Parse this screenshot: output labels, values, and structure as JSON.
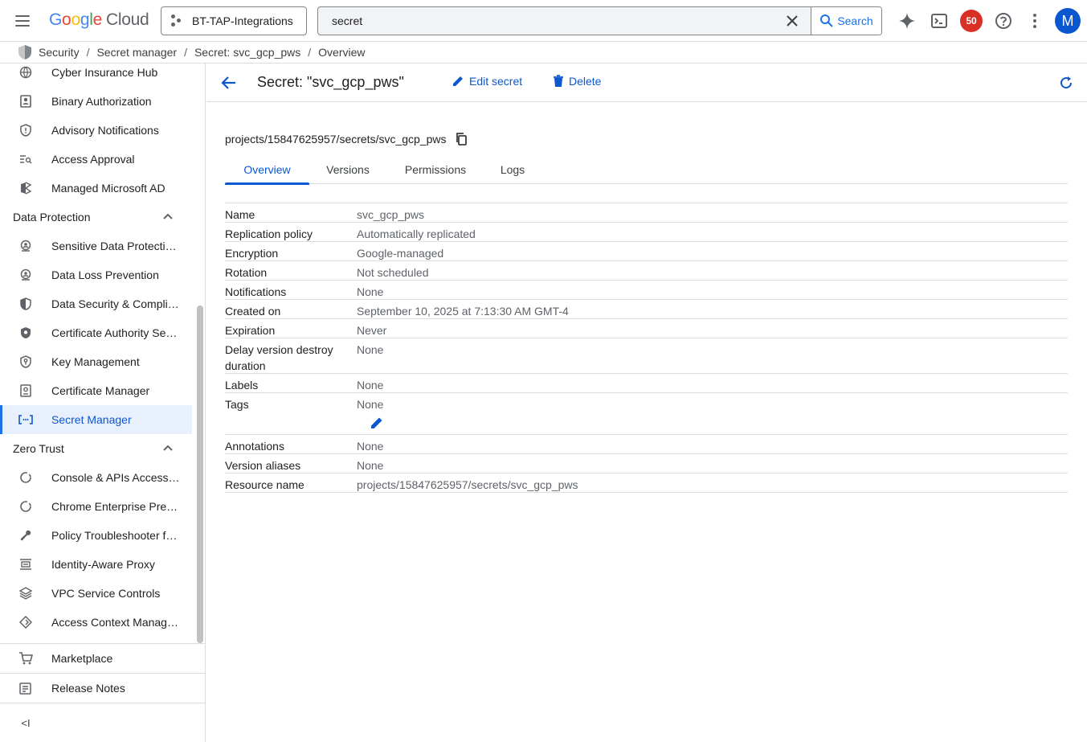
{
  "topbar": {
    "logo": {
      "letters": [
        "G",
        "o",
        "o",
        "g",
        "l",
        "e"
      ],
      "product": "Cloud"
    },
    "project": "BT-TAP-Integrations",
    "search_value": "secret",
    "search_button": "Search",
    "notifications_count": "50",
    "avatar_letter": "M",
    "icons": [
      "menu-icon",
      "gemini-sparkle-icon",
      "cloud-shell-icon",
      "help-icon",
      "more-vert-icon"
    ]
  },
  "breadcrumb": [
    "Security",
    "Secret manager",
    "Secret: svc_gcp_pws",
    "Overview"
  ],
  "sidebar": {
    "items_top": [
      {
        "label": "Cyber Insurance Hub",
        "icon": "globe-icon"
      },
      {
        "label": "Binary Authorization",
        "icon": "badge-icon"
      },
      {
        "label": "Advisory Notifications",
        "icon": "shield-alert-icon"
      },
      {
        "label": "Access Approval",
        "icon": "search-list-icon"
      },
      {
        "label": "Managed Microsoft AD",
        "icon": "ad-icon"
      }
    ],
    "section_data_protection": "Data Protection",
    "items_data_protection": [
      {
        "label": "Sensitive Data Protecti…",
        "icon": "sensitive-data-icon"
      },
      {
        "label": "Data Loss Prevention",
        "icon": "dlp-icon"
      },
      {
        "label": "Data Security & Compli…",
        "icon": "half-shield-icon"
      },
      {
        "label": "Certificate Authority Se…",
        "icon": "shield-cert-icon"
      },
      {
        "label": "Key Management",
        "icon": "key-shield-icon"
      },
      {
        "label": "Certificate Manager",
        "icon": "certificate-icon"
      },
      {
        "label": "Secret Manager",
        "icon": "secret-manager-icon",
        "active": true
      }
    ],
    "section_zero_trust": "Zero Trust",
    "items_zero_trust": [
      {
        "label": "Console & APIs Access…",
        "icon": "circle-dashed-icon"
      },
      {
        "label": "Chrome Enterprise Pre…",
        "icon": "circle-dashed-icon"
      },
      {
        "label": "Policy Troubleshooter f…",
        "icon": "wrench-icon"
      },
      {
        "label": "Identity-Aware Proxy",
        "icon": "iap-icon"
      },
      {
        "label": "VPC Service Controls",
        "icon": "vpc-icon"
      },
      {
        "label": "Access Context Manag…",
        "icon": "access-context-icon"
      }
    ],
    "marketplace": "Marketplace",
    "release_notes": "Release Notes",
    "collapse_label": "<I"
  },
  "main": {
    "title": "Secret: \"svc_gcp_pws\"",
    "edit_label": "Edit secret",
    "delete_label": "Delete",
    "resource_path": "projects/15847625957/secrets/svc_gcp_pws",
    "tabs": [
      "Overview",
      "Versions",
      "Permissions",
      "Logs"
    ],
    "details": [
      {
        "key": "Name",
        "value": "svc_gcp_pws"
      },
      {
        "key": "Replication policy",
        "value": "Automatically replicated"
      },
      {
        "key": "Encryption",
        "value": "Google-managed"
      },
      {
        "key": "Rotation",
        "value": "Not scheduled"
      },
      {
        "key": "Notifications",
        "value": "None"
      },
      {
        "key": "Created on",
        "value": "September 10, 2025 at 7:13:30 AM GMT-4"
      },
      {
        "key": "Expiration",
        "value": "Never"
      },
      {
        "key": "Delay version destroy duration",
        "value": "None"
      },
      {
        "key": "Labels",
        "value": "None"
      },
      {
        "key": "Tags",
        "value": "None"
      },
      {
        "key": "Annotations",
        "value": "None"
      },
      {
        "key": "Version aliases",
        "value": "None"
      },
      {
        "key": "Resource name",
        "value": "projects/15847625957/secrets/svc_gcp_pws"
      }
    ]
  },
  "colors": {
    "accent": "#0b57d0",
    "active_bg": "#e8f0fe",
    "badge": "#d93025"
  }
}
